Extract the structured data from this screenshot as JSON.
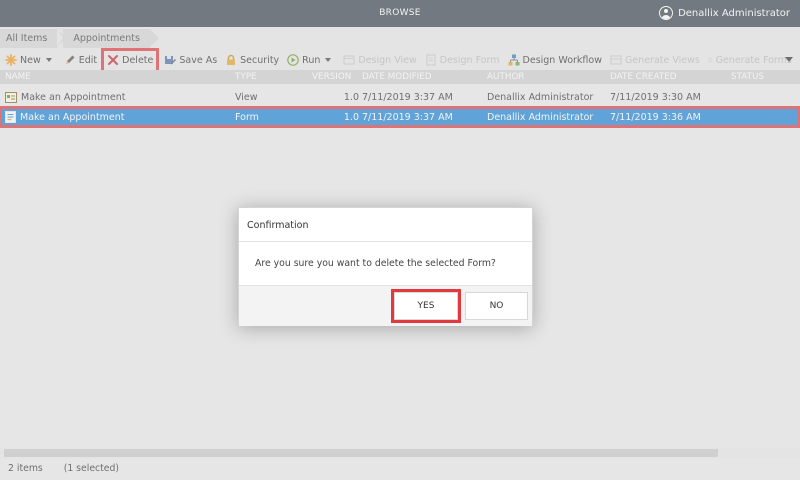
{
  "header": {
    "title": "BROWSE",
    "user_name": "Denallix Administrator"
  },
  "breadcrumb": {
    "items": [
      "All Items",
      "Appointments"
    ]
  },
  "toolbar": {
    "new": "New",
    "edit": "Edit",
    "delete": "Delete",
    "save_as": "Save As",
    "security": "Security",
    "run": "Run",
    "design_view": "Design View",
    "design_form": "Design Form",
    "design_workflow": "Design Workflow",
    "generate_views": "Generate Views",
    "generate_forms": "Generate Forms"
  },
  "grid": {
    "columns": [
      "NAME",
      "TYPE",
      "VERSION",
      "DATE MODIFIED",
      "AUTHOR",
      "DATE CREATED",
      "STATUS"
    ],
    "rows": [
      {
        "name": "Make an Appointment",
        "type": "View",
        "version": "1.0",
        "modified": "7/11/2019 3:37 AM",
        "author": "Denallix Administrator",
        "created": "7/11/2019 3:30 AM",
        "status": ""
      },
      {
        "name": "Make an Appointment",
        "type": "Form",
        "version": "1.0",
        "modified": "7/11/2019 3:37 AM",
        "author": "Denallix Administrator",
        "created": "7/11/2019 3:36 AM",
        "status": ""
      }
    ]
  },
  "dialog": {
    "title": "Confirmation",
    "message": "Are you sure you want to delete the selected Form?",
    "yes": "YES",
    "no": "NO"
  },
  "status": {
    "count": "2 items",
    "selected": "(1 selected)"
  },
  "colors": {
    "topbar": "#3a4451",
    "selection": "#1d85d8",
    "highlight": "#e03a3e"
  }
}
